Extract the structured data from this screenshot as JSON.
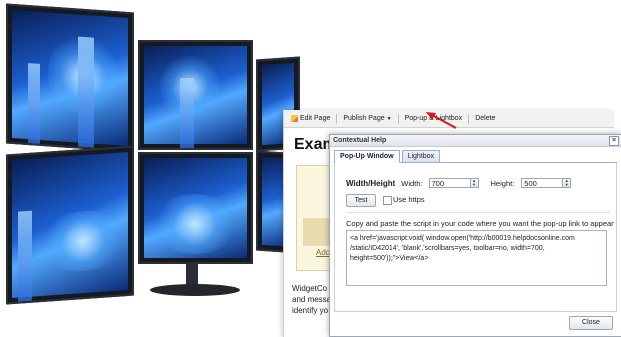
{
  "toolbar": {
    "edit_page": "Edit Page",
    "publish_page": "Publish Page",
    "popup_lightbox": "Pop-up & Lightbox",
    "delete": "Delete"
  },
  "page": {
    "title": "Exam",
    "thumb_link": "Add",
    "body_lines": [
      "WidgetCo",
      "and messa",
      "identify yo"
    ]
  },
  "dialog": {
    "title": "Contextual Help",
    "close_glyph": "×",
    "tabs": [
      {
        "label": "Pop-Up Window",
        "active": true
      },
      {
        "label": "Lightbox",
        "active": false
      }
    ],
    "wh_label": "Width/Height",
    "width_label": "Width:",
    "width_value": "700",
    "height_label": "Height:",
    "height_value": "500",
    "test_label": "Test",
    "https_label": "Use https",
    "https_checked": false,
    "instructions": "Copy and paste the script in your code where you want the pop-up link to appear",
    "code": "<a href='javascript:void( window.open('http://b00019.helpdocsonline.com\n/static/ID42014', 'blank','scrollbars=yes, toolbar=no, width=700,\nheight=500'));\">View</a>",
    "close_label": "Close"
  },
  "colors": {
    "accent_red": "#c8201c",
    "screen_blue": "#1c5fd0",
    "dialog_border": "#9aa7b6"
  }
}
